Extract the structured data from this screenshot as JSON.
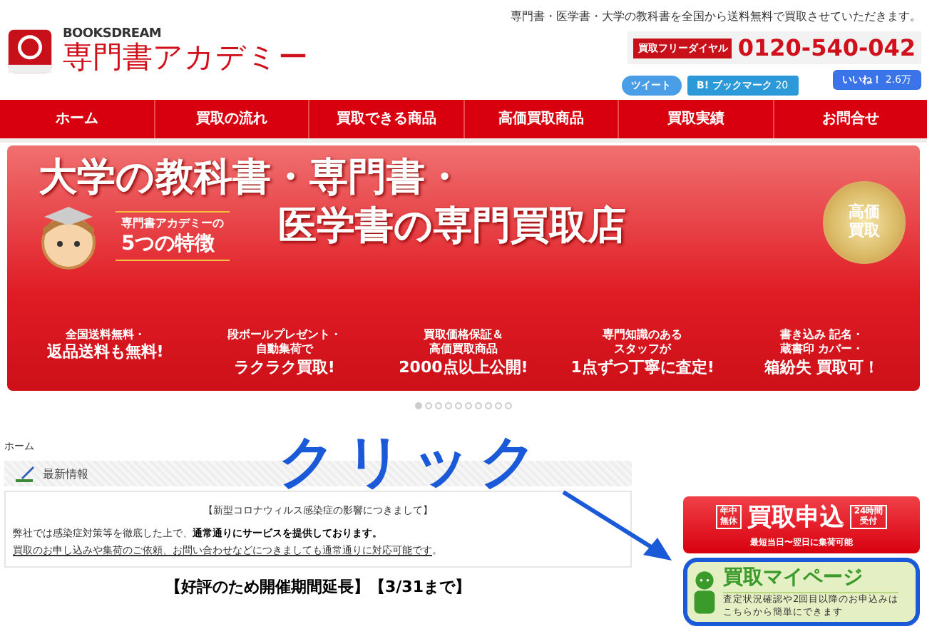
{
  "header": {
    "brand": "BOOKSDREAM",
    "site_name": "専門書アカデミー",
    "tagline": "専門書・医学書・大学の教科書を全国から送料無料で買取させていただきます。",
    "dial_label": "買取フリーダイヤル",
    "phone": "0120-540-042",
    "share": [
      {
        "kind": "tweet",
        "label": "ツイート"
      },
      {
        "kind": "bookmark",
        "label": "B! ブックマーク",
        "count": "20"
      },
      {
        "kind": "like",
        "label": "いいね！",
        "count": "2.6万"
      }
    ]
  },
  "nav": [
    {
      "label": "ホーム"
    },
    {
      "label": "買取の流れ"
    },
    {
      "label": "買取できる商品"
    },
    {
      "label": "高価買取商品"
    },
    {
      "label": "買取実績"
    },
    {
      "label": "お問合せ"
    }
  ],
  "hero": {
    "headline": [
      "大学の教科書・専門書・",
      "医学書の専門買取店"
    ],
    "seal": [
      "高価",
      "買取"
    ],
    "caption": [
      "専門書アカデミーの",
      "5つの特徴"
    ],
    "features": [
      [
        "全国送料無料・",
        "返品送料も無料!"
      ],
      [
        "段ボールプレゼント・",
        "自動集荷で",
        "ラクラク買取!"
      ],
      [
        "買取価格保証＆",
        "高価買取商品",
        "2000点以上公開!"
      ],
      [
        "専門知識のある",
        "スタッフが",
        "1点ずつ丁寧に査定!"
      ],
      [
        "書き込み 記名・",
        "蔵書印 カバー・",
        "箱紛失 買取可！"
      ]
    ]
  },
  "slider_dots": [
    {
      "selected": true
    },
    {
      "selected": false
    },
    {
      "selected": false
    },
    {
      "selected": false
    },
    {
      "selected": false
    },
    {
      "selected": false
    },
    {
      "selected": false
    },
    {
      "selected": false
    },
    {
      "selected": false
    },
    {
      "selected": false
    }
  ],
  "breadcrumb": "ホーム",
  "news": {
    "title": "最新情報",
    "notice_title": "【新型コロナウィルス感染症の影響につきまして】",
    "body": "弊社では感染症対策等を徹底した上で、**通常通りにサービスを提供しております。**",
    "link": "買取のお申し込みや集荷のご依頼、お問い合わせなどにつきましても通常通りに対応可能です",
    "body_end": "。"
  },
  "heading": "【好評のため開催期間延長】【3/31まで】",
  "side": {
    "apply": {
      "badge_left": [
        "年中",
        "無休"
      ],
      "label": "買取申込",
      "badge_right": [
        "24時間",
        "受付"
      ],
      "note": "最短当日〜翌日に集荷可能"
    },
    "mypage": {
      "label": "買取マイページ",
      "note": [
        "査定状況確認や2回目以降のお申込みは",
        "こちらから簡単にできます"
      ],
      "highlighted": true
    }
  },
  "annotation": {
    "text": "クリック"
  }
}
